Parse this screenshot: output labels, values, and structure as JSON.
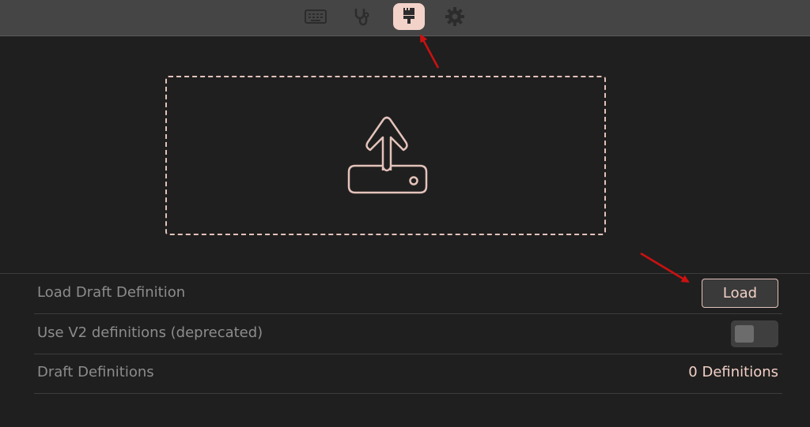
{
  "toolbar": {
    "tabs": [
      {
        "name": "keyboard",
        "icon": "keyboard-icon",
        "active": false
      },
      {
        "name": "diagnostics",
        "icon": "stethoscope-icon",
        "active": false
      },
      {
        "name": "draft",
        "icon": "paintbrush-icon",
        "active": true
      },
      {
        "name": "settings",
        "icon": "gear-icon",
        "active": false
      }
    ]
  },
  "dropzone": {
    "icon": "upload-icon"
  },
  "settings": {
    "load_draft": {
      "label": "Load Draft Definition",
      "button": "Load"
    },
    "use_v2": {
      "label": "Use V2 definitions (deprecated)",
      "enabled": false
    },
    "draft_definitions": {
      "label": "Draft Definitions",
      "value": "0 Definitions"
    }
  },
  "colors": {
    "accent": "#f2d2c9",
    "background": "#201f1f",
    "toolbar": "#454545",
    "annotation_arrow": "#cc1111"
  }
}
